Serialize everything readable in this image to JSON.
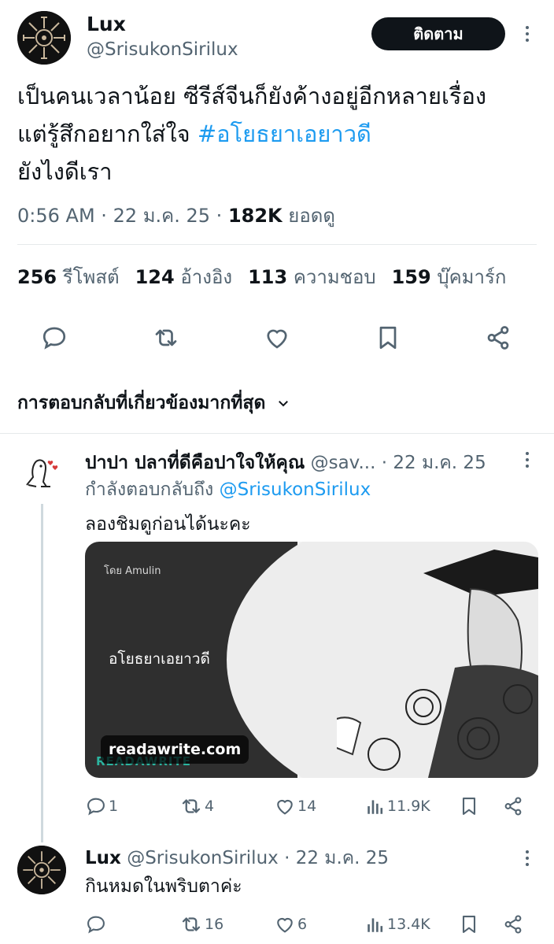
{
  "tweet": {
    "author_name": "Lux",
    "author_handle": "@SrisukonSirilux",
    "follow_label": "ติดตาม",
    "text_line1": "เป็นคนเวลาน้อย ซีรีส์จีนก็ยังค้างอยู่อีกหลายเรื่อง",
    "text_line2_prefix": "แต่รู้สึกอยากใส่ใจ ",
    "hashtag": "#อโยธยาเอยาวดี",
    "text_line3": "ยังไงดีเรา",
    "time": "0:56 AM",
    "date": "22 ม.ค. 25",
    "views_count": "182K",
    "views_label": "ยอดดู"
  },
  "stats": {
    "reposts_count": "256",
    "reposts_label": "รีโพสต์",
    "quotes_count": "124",
    "quotes_label": "อ้างอิง",
    "likes_count": "113",
    "likes_label": "ความชอบ",
    "bookmarks_count": "159",
    "bookmarks_label": "บุ๊คมาร์ก"
  },
  "sort_label": "การตอบกลับที่เกี่ยวข้องมากที่สุด",
  "replies": [
    {
      "name": "ปาปา ปลาที่ดีคือปาใจให้คุณ",
      "handle": "@sav...",
      "date": "· 22 ม.ค. 25",
      "replying_to_label": "กำลังตอบกลับถึง ",
      "replying_to_handle": "@SrisukonSirilux",
      "text": "ลองชิมดูก่อนได้นะคะ",
      "card": {
        "by_label": "โดย  Amulin",
        "title": "อโยธยาเอยาวดี",
        "domain": "readawrite.com",
        "brand": "READAWRITE"
      },
      "counts": {
        "replies": "1",
        "reposts": "4",
        "likes": "14",
        "views": "11.9K"
      }
    },
    {
      "name": "Lux",
      "handle": "@SrisukonSirilux",
      "date": "· 22 ม.ค. 25",
      "text": "กินหมดในพริบตาค่ะ",
      "counts": {
        "replies": "",
        "reposts": "16",
        "likes": "6",
        "views": "13.4K"
      }
    }
  ],
  "colors": {
    "link": "#1d9bf0",
    "muted": "#536471",
    "text": "#0f1419"
  }
}
